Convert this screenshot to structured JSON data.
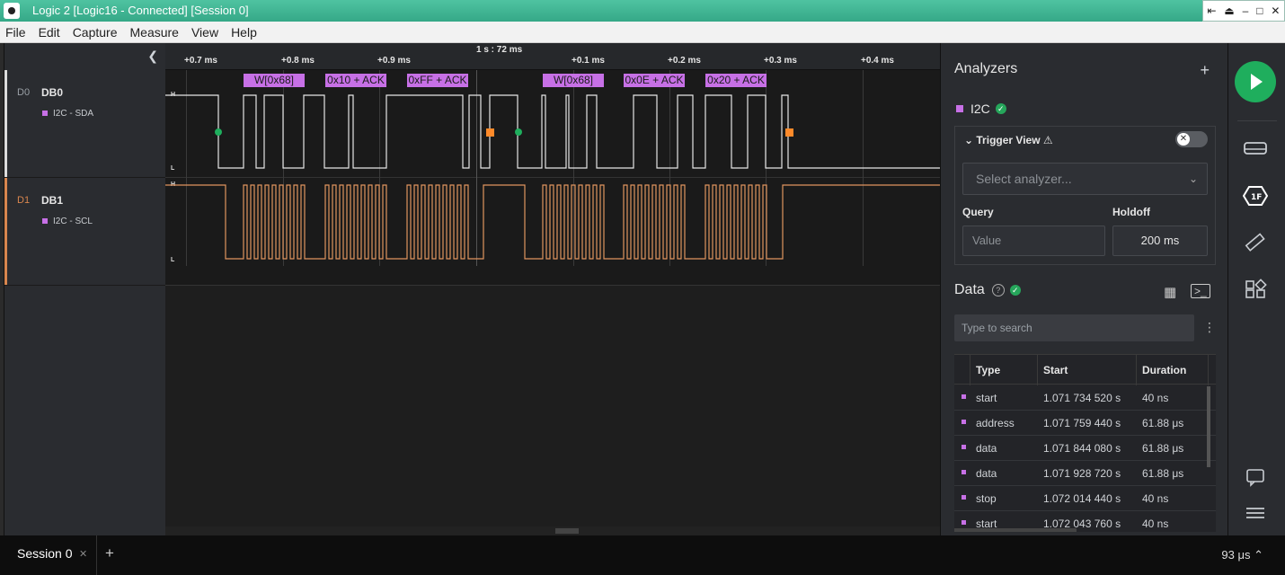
{
  "window": {
    "title": "Logic 2 [Logic16 - Connected] [Session 0]"
  },
  "menu": [
    "File",
    "Edit",
    "Capture",
    "Measure",
    "View",
    "Help"
  ],
  "channels": [
    {
      "id": "D0",
      "name": "DB0",
      "analyzer": "I2C - SDA",
      "color": "#dcdcdc"
    },
    {
      "id": "D1",
      "name": "DB1",
      "analyzer": "I2C - SCL",
      "color": "#d9864e"
    }
  ],
  "ruler": {
    "center": "1 s : 72 ms",
    "ticks": [
      "+0.7 ms",
      "+0.8 ms",
      "+0.9 ms",
      "+0.1 ms",
      "+0.2 ms",
      "+0.3 ms",
      "+0.4 ms"
    ]
  },
  "decoded_labels": [
    "W[0x68]",
    "0x10 + ACK",
    "0xFF + ACK",
    "W[0x68]",
    "0x0E + ACK",
    "0x20 + ACK"
  ],
  "levels": {
    "high": "H",
    "low": "L"
  },
  "analyzers": {
    "title": "Analyzers",
    "add": "+",
    "item": "I2C",
    "trigger": {
      "title": "Trigger View",
      "select_placeholder": "Select analyzer...",
      "query_label": "Query",
      "query_placeholder": "Value",
      "holdoff_label": "Holdoff",
      "holdoff_value": "200 ms"
    }
  },
  "data": {
    "title": "Data",
    "search_placeholder": "Type to search",
    "columns": [
      "Type",
      "Start",
      "Duration"
    ],
    "rows": [
      {
        "type": "start",
        "start": "1.071 734 520 s",
        "duration": "40 ns"
      },
      {
        "type": "address",
        "start": "1.071 759 440 s",
        "duration": "61.88 μs"
      },
      {
        "type": "data",
        "start": "1.071 844 080 s",
        "duration": "61.88 μs"
      },
      {
        "type": "data",
        "start": "1.071 928 720 s",
        "duration": "61.88 μs"
      },
      {
        "type": "stop",
        "start": "1.072 014 440 s",
        "duration": "40 ns"
      },
      {
        "type": "start",
        "start": "1.072 043 760 s",
        "duration": "40 ns"
      }
    ]
  },
  "status": {
    "session_tab": "Session 0",
    "zoom": "93 μs"
  }
}
